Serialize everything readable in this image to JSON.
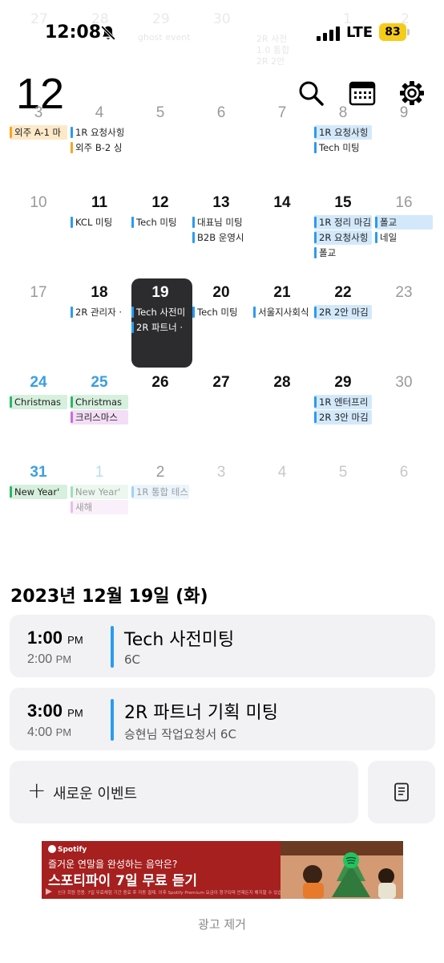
{
  "status_bar": {
    "time": "12:08",
    "network": "LTE",
    "battery": "83"
  },
  "header": {
    "month": "12"
  },
  "ghost": {
    "days": [
      "27",
      "28",
      "29",
      "30",
      "1",
      "2"
    ],
    "texts": [
      "ghost event",
      "2R 사전",
      "1.0 통합",
      "2R 2안"
    ]
  },
  "colors": {
    "orange": "#f5a623",
    "orange_bg": "#fde9c8",
    "blue": "#2a9bf0",
    "blue_bg": "#d3e9fb",
    "green": "#2fb566",
    "green_bg": "#d6f0dd",
    "purple": "#c86dd7",
    "purple_bg": "#f3def6",
    "selected_bg": "#2c2c2e"
  },
  "calendar": {
    "weeks": [
      {
        "days": [
          {
            "num": "3",
            "style": "gray",
            "events": [
              {
                "text": "외주 A-1 마",
                "color": "orange",
                "filled": true
              }
            ]
          },
          {
            "num": "4",
            "style": "gray",
            "events": [
              {
                "text": "1R 요청사힝",
                "color": "blue",
                "filled": false
              },
              {
                "text": "외주 B-2 싱",
                "color": "orange",
                "filled": false
              }
            ]
          },
          {
            "num": "5",
            "style": "gray",
            "events": []
          },
          {
            "num": "6",
            "style": "gray",
            "events": []
          },
          {
            "num": "7",
            "style": "gray",
            "events": []
          },
          {
            "num": "8",
            "style": "gray",
            "events": [
              {
                "text": "1R 요청사힝",
                "color": "blue",
                "filled": true
              },
              {
                "text": "Tech 미팅",
                "color": "blue",
                "filled": false
              }
            ]
          },
          {
            "num": "9",
            "style": "gray",
            "events": []
          }
        ]
      },
      {
        "days": [
          {
            "num": "10",
            "style": "gray",
            "events": []
          },
          {
            "num": "11",
            "style": "",
            "events": [
              {
                "text": "KCL 미팅",
                "color": "blue",
                "filled": false
              }
            ]
          },
          {
            "num": "12",
            "style": "",
            "events": [
              {
                "text": "Tech 미팅",
                "color": "blue",
                "filled": false
              }
            ]
          },
          {
            "num": "13",
            "style": "",
            "events": [
              {
                "text": "대표님 미팅",
                "color": "blue",
                "filled": false
              },
              {
                "text": "B2B 운영시",
                "color": "blue",
                "filled": false
              }
            ]
          },
          {
            "num": "14",
            "style": "",
            "events": []
          },
          {
            "num": "15",
            "style": "",
            "events": [
              {
                "text": "1R 정리 마김",
                "color": "blue",
                "filled": true
              },
              {
                "text": "2R 요청사힝",
                "color": "blue",
                "filled": true
              },
              {
                "text": "폴교",
                "color": "blue",
                "filled": false
              }
            ]
          },
          {
            "num": "16",
            "style": "gray",
            "events": [
              {
                "text": "폴교",
                "color": "blue",
                "filled": true
              },
              {
                "text": "네일",
                "color": "blue",
                "filled": false
              }
            ]
          }
        ]
      },
      {
        "days": [
          {
            "num": "17",
            "style": "gray",
            "events": []
          },
          {
            "num": "18",
            "style": "",
            "events": [
              {
                "text": "2R 관리자 ·",
                "color": "blue",
                "filled": false
              }
            ]
          },
          {
            "num": "19",
            "style": "selected",
            "events": [
              {
                "text": "Tech 사전미",
                "color": "blue",
                "filled": false
              },
              {
                "text": "2R 파트너 ·",
                "color": "blue",
                "filled": false
              }
            ]
          },
          {
            "num": "20",
            "style": "",
            "events": [
              {
                "text": "Tech 미팅",
                "color": "blue",
                "filled": false
              }
            ]
          },
          {
            "num": "21",
            "style": "",
            "events": [
              {
                "text": "서울지사회식",
                "color": "blue",
                "filled": false
              }
            ]
          },
          {
            "num": "22",
            "style": "",
            "events": [
              {
                "text": "2R 2안 마김",
                "color": "blue",
                "filled": true
              }
            ]
          },
          {
            "num": "23",
            "style": "gray",
            "events": []
          }
        ]
      },
      {
        "days": [
          {
            "num": "24",
            "style": "sun",
            "events": [
              {
                "text": "Christmas",
                "color": "green",
                "filled": true
              }
            ]
          },
          {
            "num": "25",
            "style": "sun",
            "events": [
              {
                "text": "Christmas",
                "color": "green",
                "filled": true
              },
              {
                "text": "크리스마스",
                "color": "purple",
                "filled": true
              }
            ]
          },
          {
            "num": "26",
            "style": "",
            "events": []
          },
          {
            "num": "27",
            "style": "",
            "events": []
          },
          {
            "num": "28",
            "style": "",
            "events": []
          },
          {
            "num": "29",
            "style": "",
            "events": [
              {
                "text": "1R 엔터프리",
                "color": "blue",
                "filled": true
              },
              {
                "text": "2R 3안 마김",
                "color": "blue",
                "filled": true
              }
            ]
          },
          {
            "num": "30",
            "style": "gray",
            "events": []
          }
        ]
      },
      {
        "days": [
          {
            "num": "31",
            "style": "sun",
            "events": [
              {
                "text": "New Year'",
                "color": "green",
                "filled": true
              }
            ]
          },
          {
            "num": "1",
            "style": "faded-sun",
            "events": [
              {
                "text": "New Year'",
                "color": "green",
                "filled": true,
                "faded": true
              },
              {
                "text": "새해",
                "color": "purple",
                "filled": true,
                "faded": true
              }
            ]
          },
          {
            "num": "2",
            "style": "gray",
            "events": [
              {
                "text": "1R 통합 테스",
                "color": "blue",
                "filled": true,
                "faded": true
              }
            ]
          },
          {
            "num": "3",
            "style": "faded",
            "events": []
          },
          {
            "num": "4",
            "style": "faded",
            "events": []
          },
          {
            "num": "5",
            "style": "faded",
            "events": []
          },
          {
            "num": "6",
            "style": "faded",
            "events": []
          }
        ]
      }
    ]
  },
  "selected_day": {
    "date_label": "2023년 12월 19일 (화)",
    "events": [
      {
        "start": "1:00",
        "start_ampm": "PM",
        "end": "2:00",
        "end_ampm": "PM",
        "title": "Tech 사전미팅",
        "subtitle": "6C"
      },
      {
        "start": "3:00",
        "start_ampm": "PM",
        "end": "4:00",
        "end_ampm": "PM",
        "title": "2R 파트너 기획 미팅",
        "subtitle": "승현님 작업요청서 6C"
      }
    ],
    "new_event_label": "새로운 이벤트"
  },
  "ad": {
    "brand": "Spotify",
    "line1": "즐거운 연말을 완성하는 음악은?",
    "line2": "스포티파이 7일 무료 듣기",
    "fine_print": "신규 회원 전용. 7일 무료체험 기간 종료 후 자동 결제. 이후 Spotify Premium 요금이 청구되며 언제든지 해지할 수 있습니다.",
    "remove_label": "광고 제거"
  }
}
